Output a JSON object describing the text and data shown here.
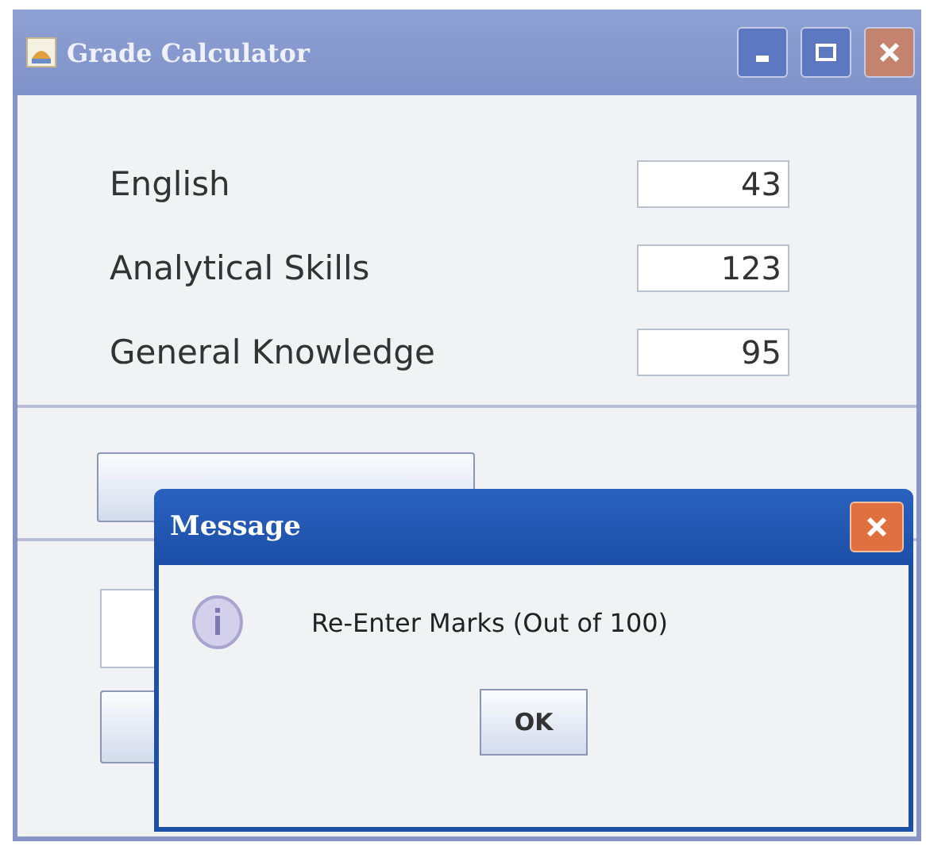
{
  "window": {
    "title": "Grade Calculator"
  },
  "fields": [
    {
      "label": "English",
      "value": "43"
    },
    {
      "label": "Analytical Skills",
      "value": "123"
    },
    {
      "label": "General Knowledge",
      "value": "95"
    }
  ],
  "dialog": {
    "title": "Message",
    "message": "Re-Enter Marks (Out of 100)",
    "buttons": [
      "OK"
    ]
  }
}
